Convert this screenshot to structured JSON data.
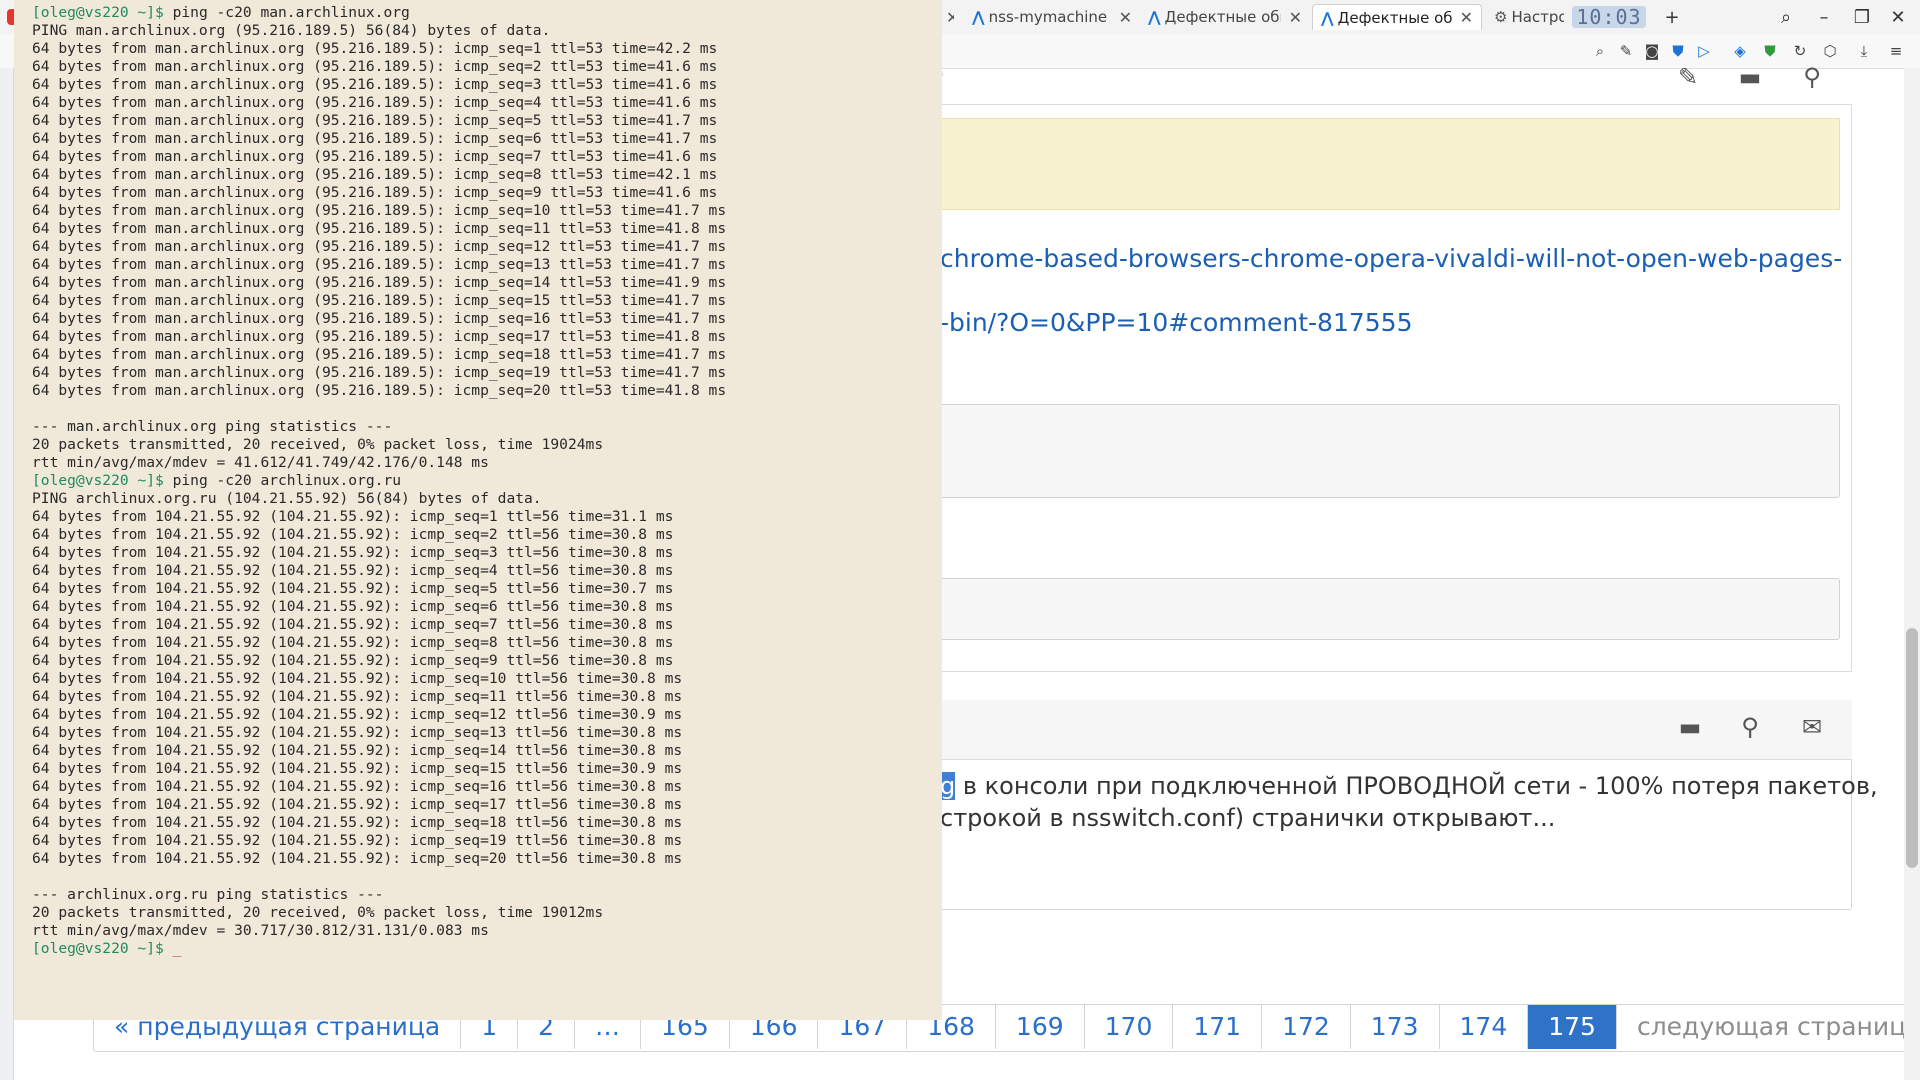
{
  "browser": {
    "tabs": [
      {
        "label": "nss-mymachine",
        "icon": "arch-icon"
      },
      {
        "label": "Дефектные обн",
        "icon": "arch-icon"
      },
      {
        "label": "Дефектные обн",
        "icon": "arch-icon",
        "active": true
      },
      {
        "label": "Настрой",
        "icon": "gear-icon"
      }
    ],
    "clock": "10:03",
    "new_tab": "+"
  },
  "page": {
    "links": [
      "chrome-based-browsers-chrome-opera-vivaldi-will-not-open-web-pages-",
      "-bin/?O=0&PP=10#comment-817555"
    ],
    "post_lines": [
      {
        "highlight": "g",
        "text": " в консоли при подключенной ПРОВОДНОЙ сети - 100% потеря пакетов,"
      },
      {
        "text": "строкой в nsswitch.conf) странички открывают..."
      }
    ],
    "top_stub": ")"
  },
  "pagination": [
    "« предыдущая страница",
    "1",
    "2",
    "…",
    "165",
    "166",
    "167",
    "168",
    "169",
    "170",
    "171",
    "172",
    "173",
    "174",
    "175",
    "следующая страница »"
  ],
  "pagination_active": "175",
  "terminal": {
    "prompt": "[oleg@vs220 ~]$",
    "blocks": [
      {
        "command": " ping -c20 man.archlinux.org",
        "header": "PING man.archlinux.org (95.216.189.5) 56(84) bytes of data.",
        "lines": [
          "64 bytes from man.archlinux.org (95.216.189.5): icmp_seq=1 ttl=53 time=42.2 ms",
          "64 bytes from man.archlinux.org (95.216.189.5): icmp_seq=2 ttl=53 time=41.6 ms",
          "64 bytes from man.archlinux.org (95.216.189.5): icmp_seq=3 ttl=53 time=41.6 ms",
          "64 bytes from man.archlinux.org (95.216.189.5): icmp_seq=4 ttl=53 time=41.6 ms",
          "64 bytes from man.archlinux.org (95.216.189.5): icmp_seq=5 ttl=53 time=41.7 ms",
          "64 bytes from man.archlinux.org (95.216.189.5): icmp_seq=6 ttl=53 time=41.7 ms",
          "64 bytes from man.archlinux.org (95.216.189.5): icmp_seq=7 ttl=53 time=41.6 ms",
          "64 bytes from man.archlinux.org (95.216.189.5): icmp_seq=8 ttl=53 time=42.1 ms",
          "64 bytes from man.archlinux.org (95.216.189.5): icmp_seq=9 ttl=53 time=41.6 ms",
          "64 bytes from man.archlinux.org (95.216.189.5): icmp_seq=10 ttl=53 time=41.7 ms",
          "64 bytes from man.archlinux.org (95.216.189.5): icmp_seq=11 ttl=53 time=41.8 ms",
          "64 bytes from man.archlinux.org (95.216.189.5): icmp_seq=12 ttl=53 time=41.7 ms",
          "64 bytes from man.archlinux.org (95.216.189.5): icmp_seq=13 ttl=53 time=41.7 ms",
          "64 bytes from man.archlinux.org (95.216.189.5): icmp_seq=14 ttl=53 time=41.9 ms",
          "64 bytes from man.archlinux.org (95.216.189.5): icmp_seq=15 ttl=53 time=41.7 ms",
          "64 bytes from man.archlinux.org (95.216.189.5): icmp_seq=16 ttl=53 time=41.7 ms",
          "64 bytes from man.archlinux.org (95.216.189.5): icmp_seq=17 ttl=53 time=41.8 ms",
          "64 bytes from man.archlinux.org (95.216.189.5): icmp_seq=18 ttl=53 time=41.7 ms",
          "64 bytes from man.archlinux.org (95.216.189.5): icmp_seq=19 ttl=53 time=41.7 ms",
          "64 bytes from man.archlinux.org (95.216.189.5): icmp_seq=20 ttl=53 time=41.8 ms"
        ],
        "stats_header": "--- man.archlinux.org ping statistics ---",
        "stats": [
          "20 packets transmitted, 20 received, 0% packet loss, time 19024ms",
          "rtt min/avg/max/mdev = 41.612/41.749/42.176/0.148 ms"
        ]
      },
      {
        "command": " ping -c20 archlinux.org.ru",
        "header": "PING archlinux.org.ru (104.21.55.92) 56(84) bytes of data.",
        "lines": [
          "64 bytes from 104.21.55.92 (104.21.55.92): icmp_seq=1 ttl=56 time=31.1 ms",
          "64 bytes from 104.21.55.92 (104.21.55.92): icmp_seq=2 ttl=56 time=30.8 ms",
          "64 bytes from 104.21.55.92 (104.21.55.92): icmp_seq=3 ttl=56 time=30.8 ms",
          "64 bytes from 104.21.55.92 (104.21.55.92): icmp_seq=4 ttl=56 time=30.8 ms",
          "64 bytes from 104.21.55.92 (104.21.55.92): icmp_seq=5 ttl=56 time=30.7 ms",
          "64 bytes from 104.21.55.92 (104.21.55.92): icmp_seq=6 ttl=56 time=30.8 ms",
          "64 bytes from 104.21.55.92 (104.21.55.92): icmp_seq=7 ttl=56 time=30.8 ms",
          "64 bytes from 104.21.55.92 (104.21.55.92): icmp_seq=8 ttl=56 time=30.8 ms",
          "64 bytes from 104.21.55.92 (104.21.55.92): icmp_seq=9 ttl=56 time=30.8 ms",
          "64 bytes from 104.21.55.92 (104.21.55.92): icmp_seq=10 ttl=56 time=30.8 ms",
          "64 bytes from 104.21.55.92 (104.21.55.92): icmp_seq=11 ttl=56 time=30.8 ms",
          "64 bytes from 104.21.55.92 (104.21.55.92): icmp_seq=12 ttl=56 time=30.9 ms",
          "64 bytes from 104.21.55.92 (104.21.55.92): icmp_seq=13 ttl=56 time=30.8 ms",
          "64 bytes from 104.21.55.92 (104.21.55.92): icmp_seq=14 ttl=56 time=30.8 ms",
          "64 bytes from 104.21.55.92 (104.21.55.92): icmp_seq=15 ttl=56 time=30.9 ms",
          "64 bytes from 104.21.55.92 (104.21.55.92): icmp_seq=16 ttl=56 time=30.8 ms",
          "64 bytes from 104.21.55.92 (104.21.55.92): icmp_seq=17 ttl=56 time=30.8 ms",
          "64 bytes from 104.21.55.92 (104.21.55.92): icmp_seq=18 ttl=56 time=30.8 ms",
          "64 bytes from 104.21.55.92 (104.21.55.92): icmp_seq=19 ttl=56 time=30.8 ms",
          "64 bytes from 104.21.55.92 (104.21.55.92): icmp_seq=20 ttl=56 time=30.8 ms"
        ],
        "stats_header": "--- archlinux.org.ru ping statistics ---",
        "stats": [
          "20 packets transmitted, 20 received, 0% packet loss, time 19012ms",
          "rtt min/avg/max/mdev = 30.717/30.812/31.131/0.083 ms"
        ]
      }
    ],
    "final_cursor": "_"
  }
}
